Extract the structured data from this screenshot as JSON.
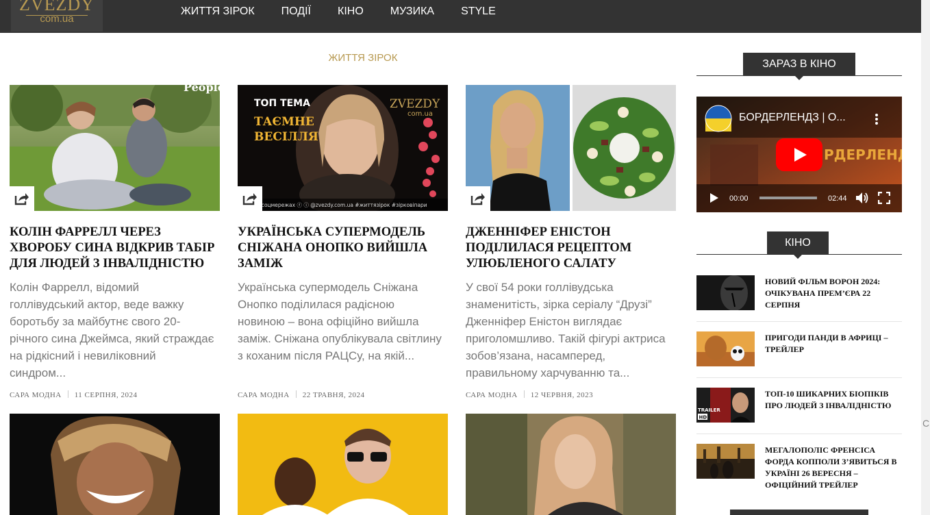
{
  "logo": {
    "name": "ZVEZDY",
    "domain": "com.ua"
  },
  "nav": [
    "ЖИТТЯ ЗІРОК",
    "ПОДІЇ",
    "КІНО",
    "МУЗИКА",
    "STYLE"
  ],
  "section_label": "ЖИТТЯ ЗІРОК",
  "articles": [
    {
      "title": "КОЛІН ФАРРЕЛЛ ЧЕРЕЗ ХВОРОБУ СИНА ВІДКРИВ ТАБІР ДЛЯ ЛЮДЕЙ З ІНВАЛІДНІСТЮ",
      "excerpt": "Колін Фаррелл, відомий голлівудський актор, веде важку боротьбу за майбутнє свого 20-річного сина Джеймса, який страждає на рідкісний і невиліковний синдром...",
      "author": "САРА МОДНА",
      "date": "11 СЕРПНЯ, 2024",
      "thumb_watermark": "People"
    },
    {
      "title": "УКРАЇНСЬКА СУПЕРМОДЕЛЬ СНІЖАНА ОНОПКО ВИЙШЛА ЗАМІЖ",
      "excerpt": "Українська супермодель Сніжана Онопко поділилася радісною новиною – вона офіційно вийшла заміж. Сніжана опублікувала світлину з коханим після РАЦСу, на якій...",
      "author": "САРА МОДНА",
      "date": "22 ТРАВНЯ, 2024",
      "thumb_top": "ТОП ТЕМА",
      "thumb_headline_1": "ТАЄМНЕ",
      "thumb_headline_2": "ВЕСІЛЛЯ",
      "thumb_logo": "ZVEZDY",
      "thumb_logo_sub": "com.ua",
      "thumb_footer": "у соцмережах  ⓕ ⓘ @zvezdy.com.ua  #життязірок #зірковіпари"
    },
    {
      "title": "ДЖЕННІФЕР ЕНІСТОН ПОДІЛИЛАСЯ РЕЦЕПТОМ УЛЮБЛЕНОГО САЛАТУ",
      "excerpt": "У свої 54 роки голлівудська знаменитість, зірка серіалу “Друзі” Дженніфер Еністон виглядає приголомшливо. Такій фігурі актриса зобов’язана, насамперед, правильному харчуванню та...",
      "author": "САРА МОДНА",
      "date": "12 ЧЕРВНЯ, 2023"
    }
  ],
  "sidebar": {
    "now_in_cinema_title": "ЗАРАЗ В КІНО",
    "video": {
      "title": "БОРДЕРЛЕНДЗ | О...",
      "poster_text": "РДЕРЛЕНДЗ",
      "current_time": "00:00",
      "duration": "02:44"
    },
    "kino_title": "КІНО",
    "kino_items": [
      {
        "title": "НОВИЙ ФІЛЬМ ВОРОН 2024: ОЧІКУВАНА ПРЕМ’ЄРА 22 СЕРПНЯ"
      },
      {
        "title": "ПРИГОДИ ПАНДИ В АФРИЦІ – ТРЕЙЛЕР"
      },
      {
        "title": "ТОП-10 ШИКАРНИХ БІОПІКІВ ПРО ЛЮДЕЙ З ІНВАЛІДНІСТЮ",
        "badge": "TRAILER",
        "badge2": "HD"
      },
      {
        "title": "МЕГАЛОПОЛІС ФРЕНСІСА ФОРДА КОППОЛИ З’ЯВИТЬСЯ В УКРАЇНІ 26 ВЕРЕСНЯ – ОФІЦІЙНИЙ ТРЕЙЛЕР"
      }
    ]
  },
  "gutter_letter": "С",
  "colors": {
    "accent": "#b89a52",
    "dark": "#333333",
    "text": "#111111",
    "muted": "#777777"
  },
  "icons": [
    "share-icon",
    "youtube-play-icon",
    "play-icon",
    "volume-icon",
    "fullscreen-icon",
    "more-icon"
  ]
}
